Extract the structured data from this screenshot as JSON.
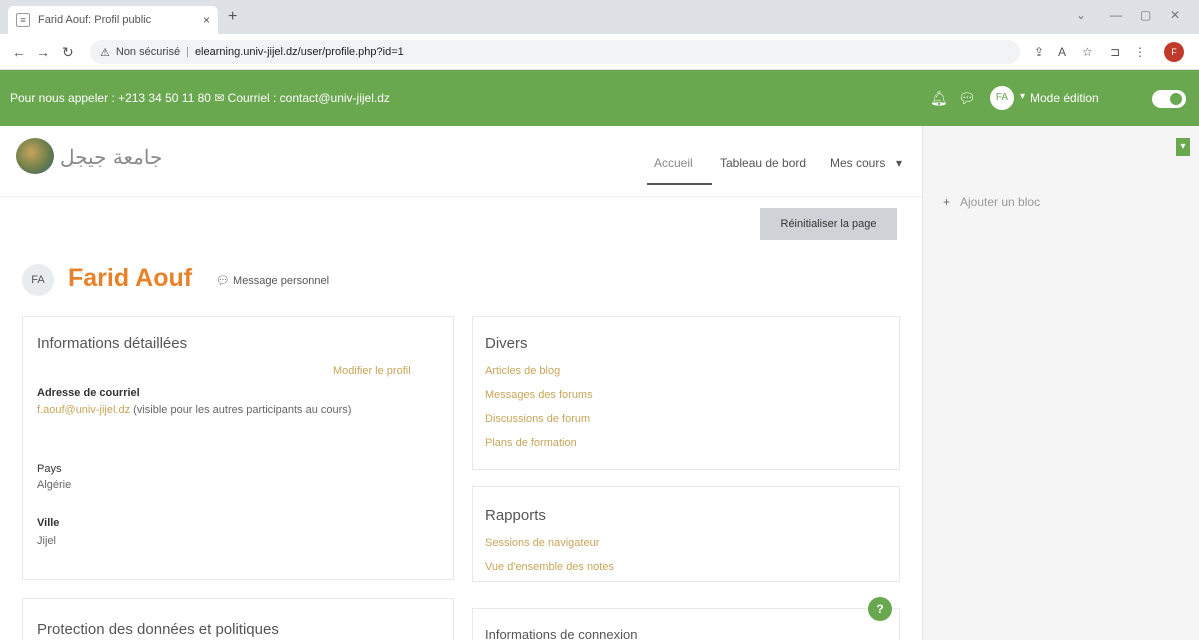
{
  "browser": {
    "tab_title": "Farid Aouf: Profil public",
    "tab_favicon": "page-icon",
    "tab_close": "×",
    "new_tab": "+",
    "omnibox_warning": "Non sécurisé",
    "url": "elearning.univ-jijel.dz/user/profile.php?id=1",
    "profile_initial": "F"
  },
  "topbar": {
    "info": "Pour nous appeler : +213 34 50 11 80  ✉ Courriel : contact@univ-jijel.dz",
    "avatar": "FA",
    "mode_label": "Mode édition",
    "accent": "#6aa84f"
  },
  "header": {
    "site_name": "جامعة جيجل",
    "nav": {
      "home": "Accueil",
      "dashboard": "Tableau de bord",
      "my_courses": "Mes cours",
      "more": "▾"
    }
  },
  "drawer": {
    "add_block": "Ajouter un bloc"
  },
  "page": {
    "reset_button": "Réinitialiser la page",
    "avatar_initials": "FA",
    "name": "Farid Aouf",
    "message_button": "Message personnel"
  },
  "details": {
    "title": "Informations détaillées",
    "edit_link": "Modifier le profil",
    "email_label": "Adresse de courriel",
    "email_value": "f.aouf@univ-jijel.dz",
    "email_note": "(visible pour les autres participants au cours)",
    "country_label": "Pays",
    "country_value": "Algérie",
    "city_label": "Ville",
    "city_value": "Jijel"
  },
  "misc": {
    "title": "Divers",
    "links": [
      "Articles de blog",
      "Messages des forums",
      "Discussions de forum",
      "Plans de formation"
    ]
  },
  "reports": {
    "title": "Rapports",
    "links": [
      "Sessions de navigateur",
      "Vue d'ensemble des notes"
    ]
  },
  "privacy": {
    "title": "Protection des données et politiques"
  },
  "login": {
    "title": "Informations de connexion"
  },
  "help_button": "?"
}
